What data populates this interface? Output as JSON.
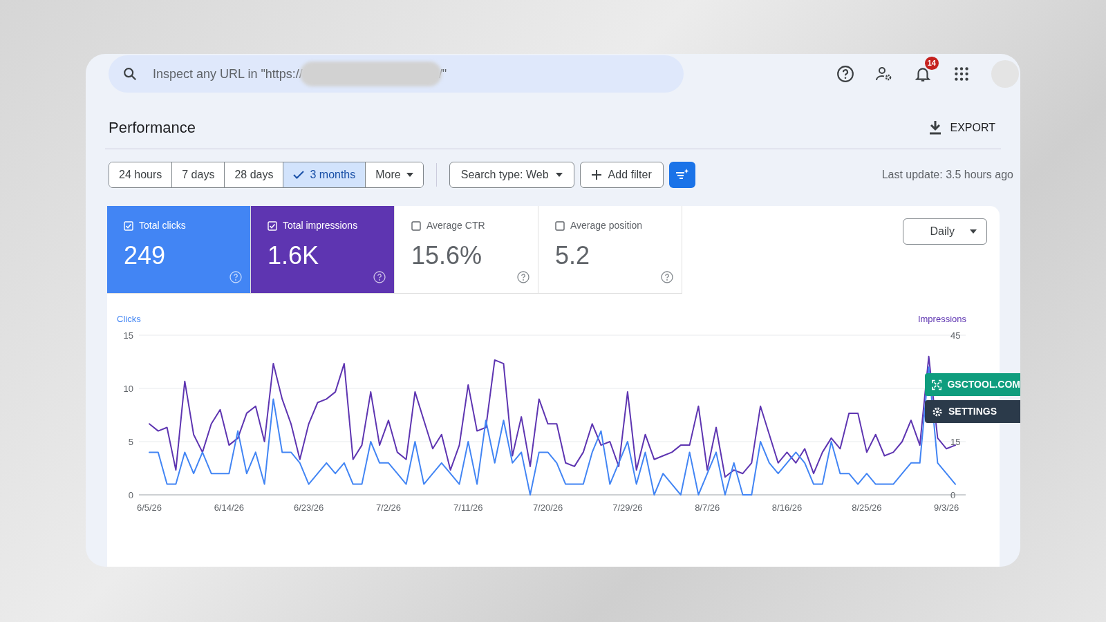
{
  "search": {
    "placeholder_start": "Inspect any URL in \"https://",
    "placeholder_end": "/\""
  },
  "header_icons": {
    "notification_count": "14"
  },
  "page_title": "Performance",
  "export_label": "EXPORT",
  "date_ranges": [
    {
      "label": "24 hours",
      "selected": false
    },
    {
      "label": "7 days",
      "selected": false
    },
    {
      "label": "28 days",
      "selected": false
    },
    {
      "label": "3 months",
      "selected": true
    },
    {
      "label": "More",
      "selected": false,
      "kind": "dropdown"
    }
  ],
  "search_type": "Search type: Web",
  "add_filter": "Add filter",
  "last_update": "Last update: 3.5 hours ago",
  "metrics": [
    {
      "label": "Total clicks",
      "value": "249",
      "selected": true,
      "color": "#4285f4"
    },
    {
      "label": "Total impressions",
      "value": "1.6K",
      "selected": true,
      "color": "#5e35b1"
    },
    {
      "label": "Average CTR",
      "value": "15.6%",
      "selected": false
    },
    {
      "label": "Average position",
      "value": "5.2",
      "selected": false
    }
  ],
  "granularity": "Daily",
  "chart": {
    "chart_data": {
      "type": "line",
      "ylim": [
        0,
        15
      ],
      "yticks": [
        0,
        5,
        10,
        15
      ],
      "y2lim": [
        0,
        45
      ],
      "y2ticks": [
        0,
        15,
        45
      ],
      "categories": [
        "6/5/26",
        null,
        null,
        null,
        null,
        null,
        null,
        null,
        null,
        "6/14/26",
        null,
        null,
        null,
        null,
        null,
        null,
        null,
        null,
        "6/23/26",
        null,
        null,
        null,
        null,
        null,
        null,
        null,
        null,
        "7/2/26",
        null,
        null,
        null,
        null,
        null,
        null,
        null,
        null,
        "7/11/26",
        null,
        null,
        null,
        null,
        null,
        null,
        null,
        null,
        "7/20/26",
        null,
        null,
        null,
        null,
        null,
        null,
        null,
        null,
        "7/29/26",
        null,
        null,
        null,
        null,
        null,
        null,
        null,
        null,
        "8/7/26",
        null,
        null,
        null,
        null,
        null,
        null,
        null,
        null,
        "8/16/26",
        null,
        null,
        null,
        null,
        null,
        null,
        null,
        null,
        "8/25/26",
        null,
        null,
        null,
        null,
        null,
        null,
        null,
        null,
        "9/3/26",
        null
      ],
      "series": [
        {
          "name": "Impressions",
          "color": "#5e35b1",
          "axis": "y2",
          "values": [
            20,
            18,
            19,
            7,
            32,
            17,
            12,
            20,
            24,
            14,
            16,
            23,
            25,
            15,
            37,
            27,
            20,
            10,
            20,
            26,
            27,
            29,
            37,
            10,
            14,
            29,
            14,
            21,
            12,
            10,
            29,
            21,
            13,
            17,
            7,
            14,
            31,
            18,
            19,
            38,
            37,
            11,
            22,
            8,
            27,
            20,
            20,
            9,
            8,
            12,
            20,
            14,
            15,
            8,
            29,
            7,
            17,
            10,
            11,
            12,
            14,
            14,
            25,
            7,
            19,
            5,
            7,
            6,
            9,
            25,
            17,
            9,
            12,
            9,
            13,
            6,
            12,
            16,
            13,
            23,
            23,
            12,
            17,
            11,
            12,
            15,
            21,
            14,
            39,
            16,
            13,
            14
          ]
        },
        {
          "name": "Clicks",
          "color": "#4285f4",
          "values": [
            4,
            4,
            1,
            1,
            4,
            2,
            4,
            2,
            2,
            2,
            6,
            2,
            4,
            1,
            9,
            4,
            4,
            3,
            1,
            2,
            3,
            2,
            3,
            1,
            1,
            5,
            3,
            3,
            2,
            1,
            5,
            1,
            2,
            3,
            2,
            1,
            5,
            1,
            7,
            3,
            7,
            3,
            4,
            0,
            4,
            4,
            3,
            1,
            1,
            1,
            4,
            6,
            1,
            3,
            5,
            1,
            4,
            0,
            2,
            1,
            0,
            4,
            0,
            2,
            4,
            0,
            3,
            0,
            0,
            5,
            3,
            2,
            3,
            4,
            3,
            1,
            1,
            5,
            2,
            2,
            1,
            2,
            1,
            1,
            1,
            2,
            3,
            3,
            12,
            3,
            2,
            1
          ]
        }
      ]
    }
  },
  "overlay_buttons": [
    {
      "label": "GSCTOOL.COM",
      "kind": "expand",
      "color": "#0f9d7e"
    },
    {
      "label": "SETTINGS",
      "kind": "gear",
      "color": "#2b3a4a"
    }
  ]
}
